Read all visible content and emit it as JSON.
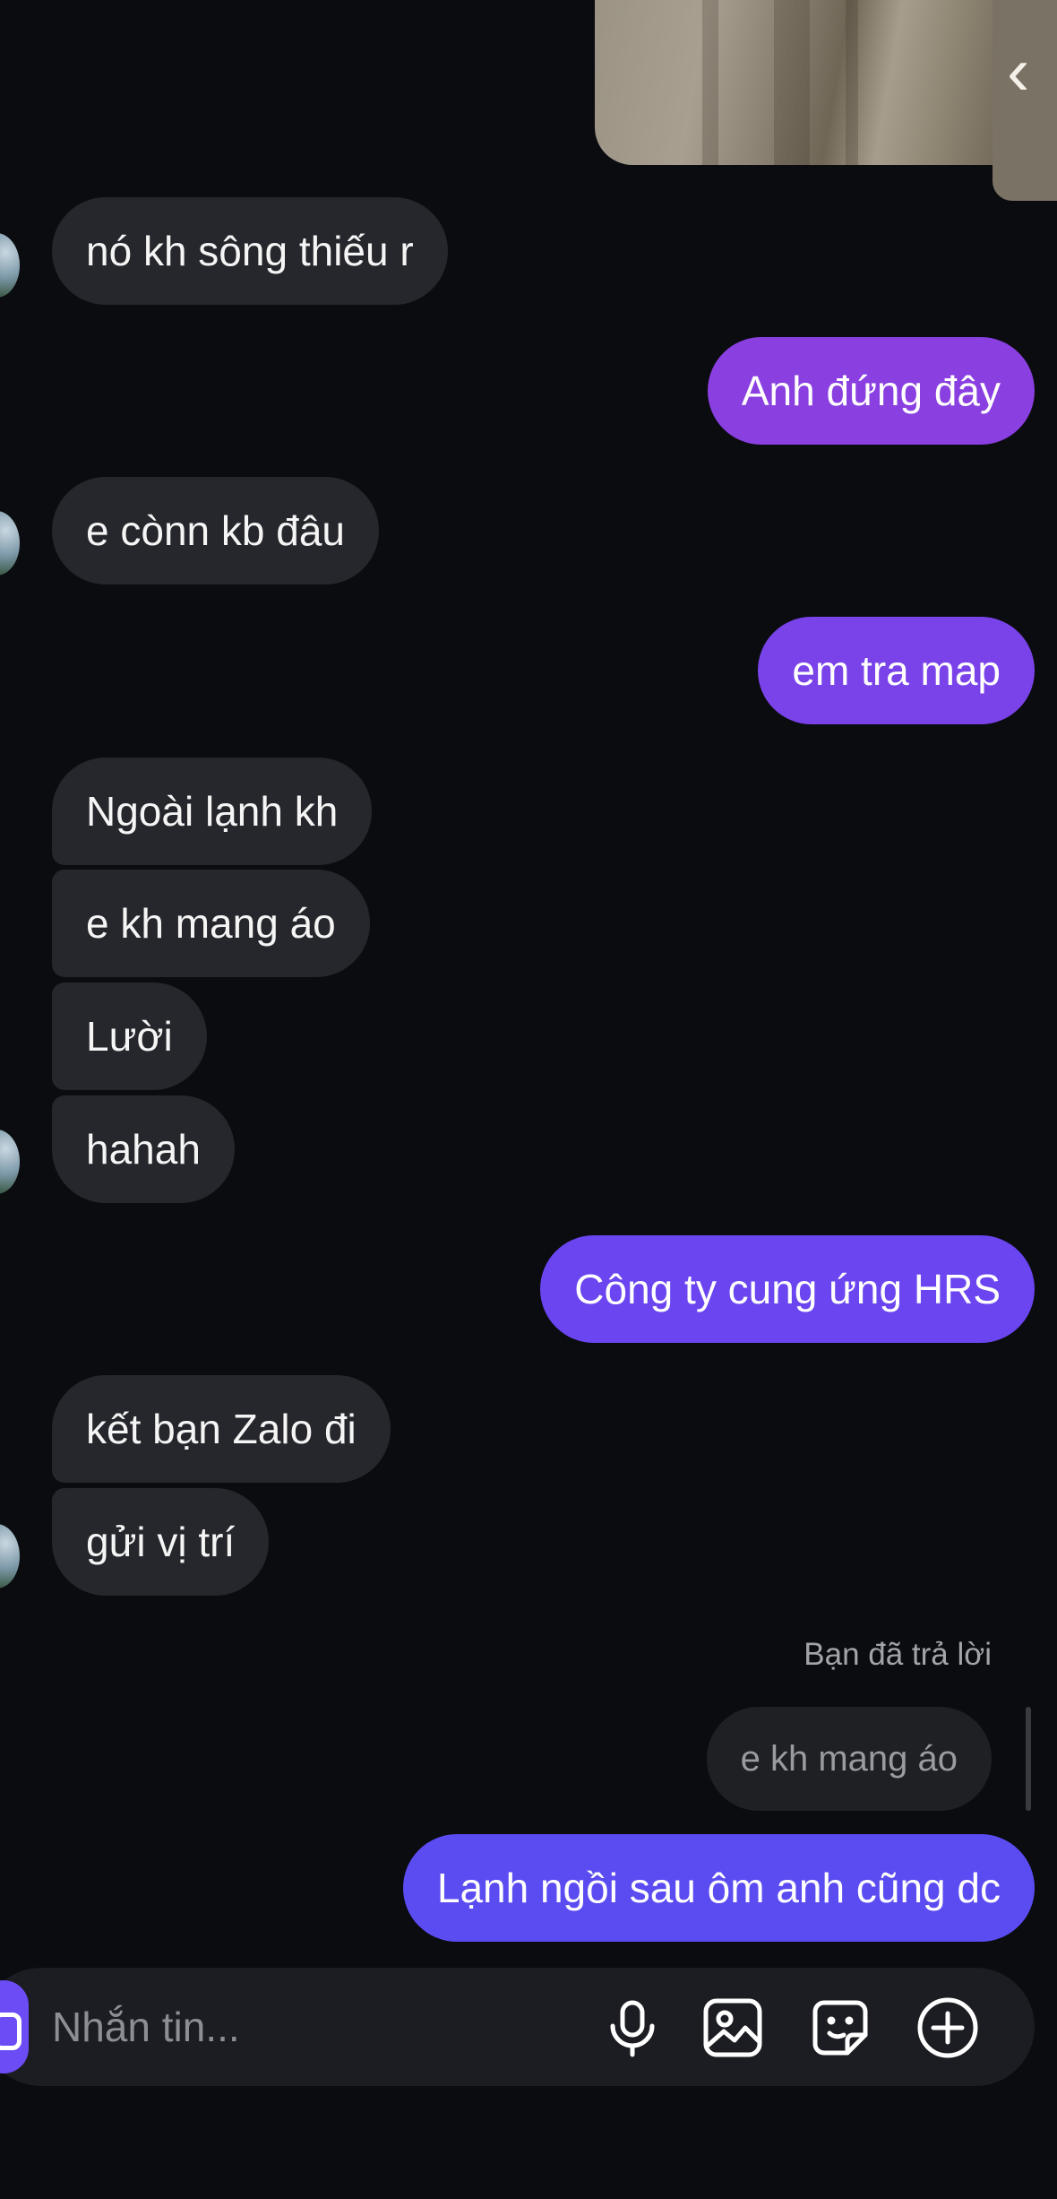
{
  "conversation": {
    "messages": [
      {
        "id": "m1",
        "side": "in",
        "text": "nó kh sông thiếu r"
      },
      {
        "id": "m2",
        "side": "out",
        "text": "Anh đứng đây"
      },
      {
        "id": "m3",
        "side": "in",
        "text": "e cònn kb đâu"
      },
      {
        "id": "m4",
        "side": "out",
        "text": "em tra map"
      },
      {
        "id": "m5",
        "side": "in",
        "text": "Ngoài lạnh kh"
      },
      {
        "id": "m6",
        "side": "in",
        "text": "e kh mang áo"
      },
      {
        "id": "m7",
        "side": "in",
        "text": "Lười"
      },
      {
        "id": "m8",
        "side": "in",
        "text": "hahah"
      },
      {
        "id": "m9",
        "side": "out",
        "text": "Công ty cung ứng HRS"
      },
      {
        "id": "m10",
        "side": "in",
        "text": "kết bạn Zalo đi"
      },
      {
        "id": "m11",
        "side": "in",
        "text": "gửi vị trí"
      },
      {
        "id": "m12",
        "side": "out",
        "text": "Lạnh ngồi sau ôm anh cũng dc"
      }
    ],
    "reply": {
      "label": "Bạn đã trả lời",
      "quoted_text": "e kh mang áo"
    }
  },
  "composer": {
    "placeholder": "Nhắn tin...",
    "icons": [
      "camera-icon",
      "microphone-icon",
      "image-icon",
      "sticker-icon",
      "plus-icon"
    ]
  },
  "colors": {
    "background": "#0b0c10",
    "incoming_bubble": "#26272c",
    "outgoing_purple": "#8a3fe0",
    "outgoing_violet": "#6a45f0",
    "outgoing_indigo": "#5b4cf2",
    "composer": "#1c1d22"
  }
}
